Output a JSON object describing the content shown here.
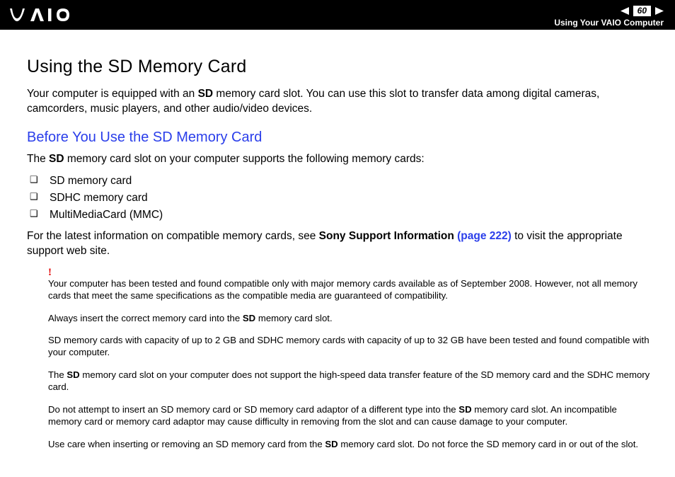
{
  "header": {
    "page_number": "60",
    "section": "Using Your VAIO Computer"
  },
  "title": "Using the SD Memory Card",
  "intro_prefix": "Your computer is equipped with an ",
  "intro_bold1": "SD",
  "intro_suffix": " memory card slot. You can use this slot to transfer data among digital cameras, camcorders, music players, and other audio/video devices.",
  "subheading": "Before You Use the SD Memory Card",
  "supports_prefix": "The ",
  "supports_bold": "SD",
  "supports_suffix": " memory card slot on your computer supports the following memory cards:",
  "bullets": [
    "SD memory card",
    "SDHC memory card",
    "MultiMediaCard (MMC)"
  ],
  "latest_prefix": "For the latest information on compatible memory cards, see ",
  "latest_bold": "Sony Support Information ",
  "latest_link": "(page 222)",
  "latest_suffix": " to visit the appropriate support web site.",
  "excl": "!",
  "notes": {
    "n1": "Your computer has been tested and found compatible only with major memory cards available as of September 2008. However, not all memory cards that meet the same specifications as the compatible media are guaranteed of compatibility.",
    "n2_prefix": "Always insert the correct memory card into the ",
    "n2_bold": "SD",
    "n2_suffix": " memory card slot.",
    "n3": "SD memory cards with capacity of up to 2 GB and SDHC memory cards with capacity of up to 32 GB have been tested and found compatible with your computer.",
    "n4_prefix": "The ",
    "n4_bold": "SD",
    "n4_suffix": " memory card slot on your computer does not support the high-speed data transfer feature of the SD memory card and the SDHC memory card.",
    "n5_prefix": "Do not attempt to insert an SD memory card or SD memory card adaptor of a different type into the ",
    "n5_bold": "SD",
    "n5_suffix": " memory card slot. An incompatible memory card or memory card adaptor may cause difficulty in removing from the slot and can cause damage to your computer.",
    "n6_prefix": "Use care when inserting or removing an SD memory card from the ",
    "n6_bold": "SD",
    "n6_suffix": " memory card slot. Do not force the SD memory card in or out of the slot."
  }
}
